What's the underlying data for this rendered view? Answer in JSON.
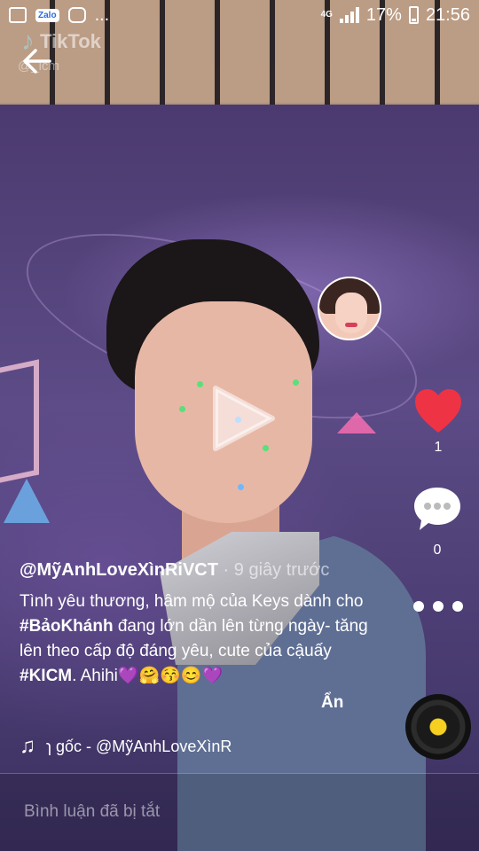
{
  "status_bar": {
    "zalo_label": "Zalo",
    "more": "...",
    "network": "4G",
    "battery": "17%",
    "time": "21:56"
  },
  "watermark": {
    "brand": "TikTok",
    "user": "@_icm"
  },
  "video": {
    "state": "paused",
    "icons": {
      "back": "back-arrow-icon",
      "play": "play-icon"
    }
  },
  "author": {
    "handle": "@MỹAnhLoveXìnRiVCT",
    "separator": "·",
    "time_ago": "9 giây trước"
  },
  "caption": {
    "text_1": "Tình yêu thương, hâm mộ của Keys dành cho ",
    "hashtag_1": "#BảoKhánh",
    "text_2": " đang lớn dần lên từng ngày- tăng lên theo cấp độ đáng yêu, cute của cậuấy ",
    "hashtag_2": "#KICM",
    "text_3": ". Ahihi💜🤗😚😊💜",
    "hide_label": "Ẩn"
  },
  "music": {
    "icon": "music-note-icon",
    "title": "ɿ gốc - @MỹAnhLoveXìnR"
  },
  "actions": {
    "like_count": "1",
    "comment_count": "0",
    "like_color": "#ee3344"
  },
  "comments": {
    "disabled_text": "Bình luận đã bị tắt"
  }
}
